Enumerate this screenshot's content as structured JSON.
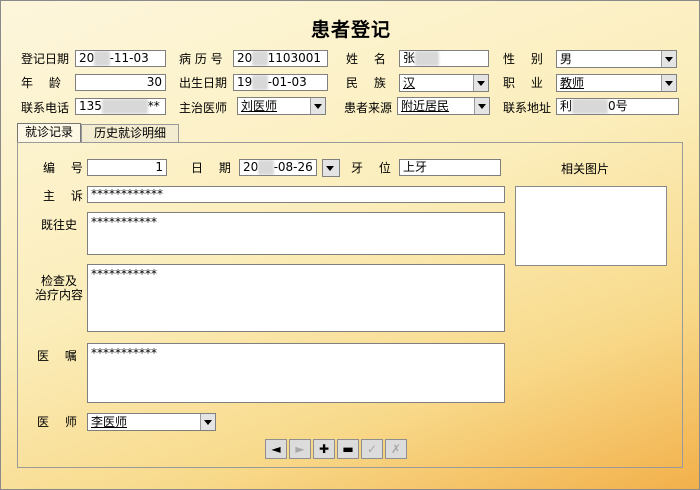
{
  "title": "患者登记",
  "header": {
    "reg_date_label": "登记日期",
    "reg_date_year": "20",
    "reg_date_rest": "-11-03",
    "record_no_label": "病 历 号",
    "record_no_prefix": "20",
    "record_no_rest": "1103001",
    "name_label": "姓　 名",
    "name_prefix": "张",
    "gender_label": "性　 别",
    "gender_value": "男",
    "age_label": "年　 龄",
    "age_value": "30",
    "birth_label": "出生日期",
    "birth_prefix": "19",
    "birth_rest": "-01-03",
    "nation_label": "民　 族",
    "nation_value": "汉",
    "job_label": "职　 业",
    "job_value": "教师",
    "phone_label": "联系电话",
    "phone_prefix": "135",
    "phone_suffix": "**",
    "doctor_label": "主治医师",
    "doctor_value": "刘医师",
    "source_label": "患者来源",
    "source_value": "附近居民",
    "address_label": "联系地址",
    "address_prefix": "利",
    "address_suffix": "0号"
  },
  "tabs": [
    "就诊记录",
    "历史就诊明细"
  ],
  "visit": {
    "no_label": "编　 号",
    "no_value": "1",
    "date_label": "日　 期",
    "date_prefix": "20",
    "date_rest": "-08-26",
    "tooth_label": "牙　 位",
    "tooth_value": "上牙",
    "image_label": "相关图片",
    "complaint_label": "主　 诉",
    "complaint_value": "************",
    "history_label": "既往史",
    "history_value": "***********",
    "exam_label_1": "检查及",
    "exam_label_2": "治疗内容",
    "exam_value": "***********",
    "advice_label": "医　 嘱",
    "advice_value": "***********",
    "physician_label": "医　 师",
    "physician_value": "李医师"
  },
  "nav": {
    "prev": "◄",
    "next": "►",
    "add": "✚",
    "delete": "▬",
    "confirm": "✓",
    "cancel": "✗"
  }
}
